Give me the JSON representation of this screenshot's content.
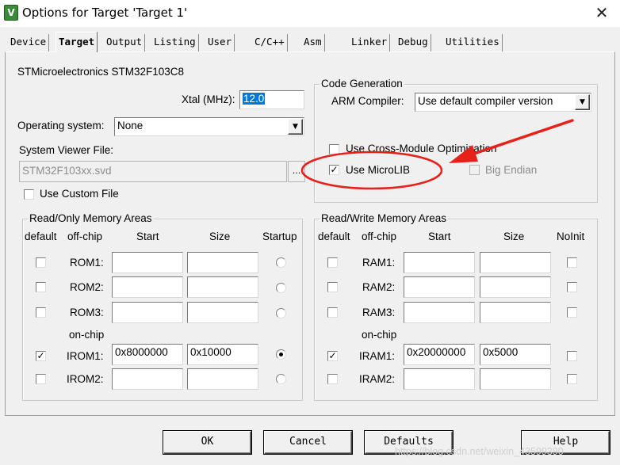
{
  "window": {
    "title": "Options for Target 'Target 1'",
    "close_glyph": "✕"
  },
  "tabs": [
    "Device",
    "Target",
    "Output",
    "Listing",
    "User",
    "C/C++",
    "Asm",
    "Linker",
    "Debug",
    "Utilities"
  ],
  "active_tab": "Target",
  "device_name": "STMicroelectronics STM32F103C8",
  "xtal": {
    "label": "Xtal (MHz):",
    "value": "12.0"
  },
  "os": {
    "label": "Operating system:",
    "value": "None"
  },
  "svf": {
    "label": "System Viewer File:",
    "value": "STM32F103xx.svd",
    "browse": "..."
  },
  "custom_file": {
    "label": "Use Custom File",
    "checked": false
  },
  "code_gen": {
    "title": "Code Generation",
    "arm_compiler_label": "ARM Compiler:",
    "arm_compiler_value": "Use default compiler version",
    "cross_module_label": "Use Cross-Module Optimization",
    "cross_module_checked": false,
    "microlib_label": "Use MicroLIB",
    "microlib_checked": true,
    "big_endian_label": "Big Endian",
    "big_endian_checked": false
  },
  "ro_mem": {
    "title": "Read/Only Memory Areas",
    "headers": {
      "default": "default",
      "offchip": "off-chip",
      "start": "Start",
      "size": "Size",
      "startup": "Startup"
    },
    "onchip_label": "on-chip",
    "rows": [
      {
        "name": "ROM1:",
        "default": false,
        "start": "",
        "size": "",
        "startup": false
      },
      {
        "name": "ROM2:",
        "default": false,
        "start": "",
        "size": "",
        "startup": false
      },
      {
        "name": "ROM3:",
        "default": false,
        "start": "",
        "size": "",
        "startup": false
      },
      {
        "name": "IROM1:",
        "default": true,
        "start": "0x8000000",
        "size": "0x10000",
        "startup": true
      },
      {
        "name": "IROM2:",
        "default": false,
        "start": "",
        "size": "",
        "startup": false
      }
    ]
  },
  "rw_mem": {
    "title": "Read/Write Memory Areas",
    "headers": {
      "default": "default",
      "offchip": "off-chip",
      "start": "Start",
      "size": "Size",
      "noinit": "NoInit"
    },
    "onchip_label": "on-chip",
    "rows": [
      {
        "name": "RAM1:",
        "default": false,
        "start": "",
        "size": "",
        "noinit": false
      },
      {
        "name": "RAM2:",
        "default": false,
        "start": "",
        "size": "",
        "noinit": false
      },
      {
        "name": "RAM3:",
        "default": false,
        "start": "",
        "size": "",
        "noinit": false
      },
      {
        "name": "IRAM1:",
        "default": true,
        "start": "0x20000000",
        "size": "0x5000",
        "noinit": false
      },
      {
        "name": "IRAM2:",
        "default": false,
        "start": "",
        "size": "",
        "noinit": false
      }
    ]
  },
  "buttons": {
    "ok": "OK",
    "cancel": "Cancel",
    "defaults": "Defaults",
    "help": "Help"
  },
  "watermark": "https://blog.csdn.net/weixin_43599390",
  "annotation_color": "#e8201a"
}
